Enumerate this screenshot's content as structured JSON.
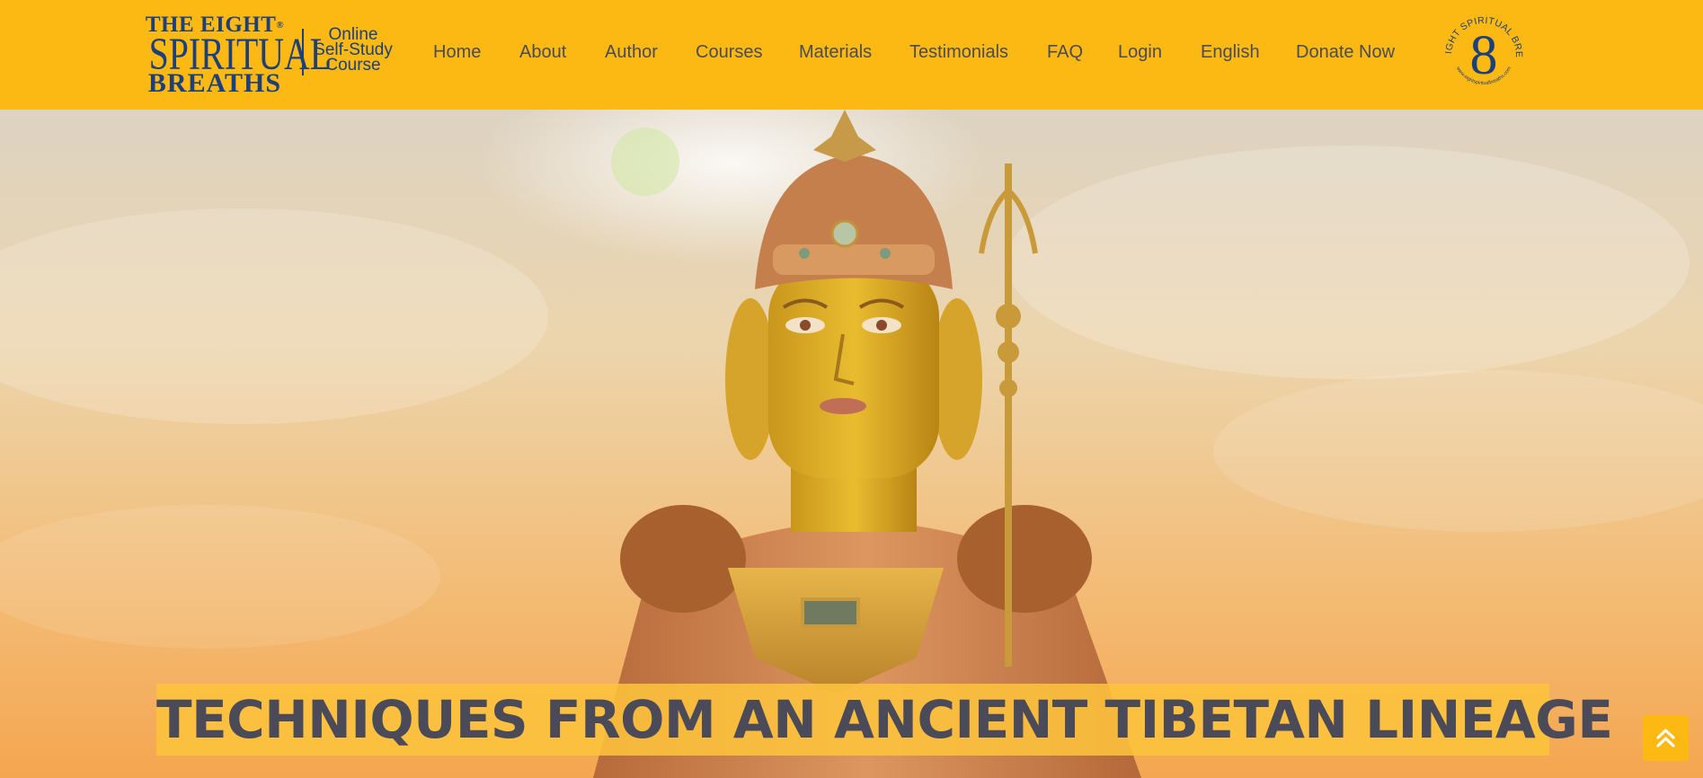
{
  "header": {
    "logo": {
      "line1": "THE EIGHT",
      "line2": "SPIRITUAL",
      "line3": "BREATHS",
      "registered": "®",
      "subtitle_lines": [
        "Online",
        "Self-Study",
        "Course"
      ]
    },
    "nav": [
      {
        "label": "Home"
      },
      {
        "label": "About"
      },
      {
        "label": "Author"
      },
      {
        "label": "Courses"
      },
      {
        "label": "Materials"
      },
      {
        "label": "Testimonials"
      },
      {
        "label": "FAQ"
      },
      {
        "label": "Login"
      },
      {
        "label": "English"
      },
      {
        "label": "Donate Now"
      }
    ],
    "badge": {
      "numeral": "8",
      "arc_text": "THE EIGHT SPIRITUAL BREATHS",
      "url_text": "www.eightspiritualbreaths.com"
    }
  },
  "hero": {
    "headline": "TECHNIQUES FROM AN ANCIENT TIBETAN LINEAGE",
    "image_subject": "golden-statue-of-padmasambhava"
  },
  "back_to_top": {
    "icon": "double-chevron-up-icon"
  },
  "colors": {
    "header_bg": "#fdb913",
    "nav_text": "#4b4b55",
    "logo_blue": "#1d3f7a",
    "headline_text": "#4a4a58",
    "headline_band": "#fdc33c"
  }
}
